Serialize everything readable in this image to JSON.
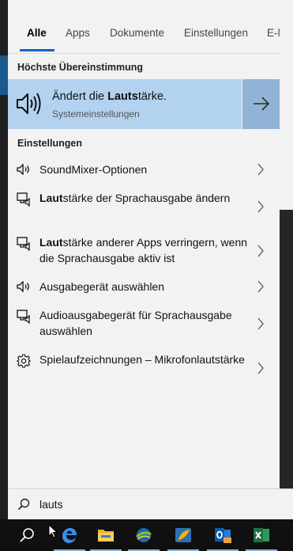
{
  "tabs": {
    "items": [
      "Alle",
      "Apps",
      "Dokumente",
      "Einstellungen",
      "E-Mai"
    ],
    "active": "Alle"
  },
  "best_match": {
    "heading": "Höchste Übereinstimmung",
    "title_pre": "Ändert die ",
    "title_bold": "Lauts",
    "title_post": "tärke.",
    "subtitle": "Systemeinstellungen",
    "icon": "speaker-icon"
  },
  "settings": {
    "heading": "Einstellungen",
    "items": [
      {
        "icon": "speaker-icon",
        "bold": "",
        "text": "SoundMixer-Optionen"
      },
      {
        "icon": "narrator-icon",
        "bold": "Laut",
        "text": "stärke der Sprachausgabe ändern"
      },
      {
        "icon": "narrator-icon",
        "bold": "Laut",
        "text": "stärke anderer Apps verringern, wenn die Sprachausgabe aktiv ist"
      },
      {
        "icon": "speaker-icon",
        "bold": "",
        "text": "Ausgabegerät auswählen"
      },
      {
        "icon": "narrator-icon",
        "bold": "",
        "text": "Audioausgabegerät für Sprachausgabe auswählen"
      },
      {
        "icon": "gear-icon",
        "bold": "",
        "text": "Spielaufzeichnungen – Mikrofonlautstärke"
      }
    ]
  },
  "search": {
    "value": "lauts",
    "icon": "search-icon"
  },
  "taskbar": {
    "items": [
      "search-icon",
      "edge-icon",
      "file-explorer-icon",
      "network-app-icon",
      "feather-app-icon",
      "outlook-icon",
      "excel-icon"
    ]
  },
  "colors": {
    "accent": "#0b63c4",
    "selection": "#b3d2ef",
    "selection_arrow": "#91b4d6",
    "panel": "#f2f2f2",
    "taskbar": "#101010"
  }
}
